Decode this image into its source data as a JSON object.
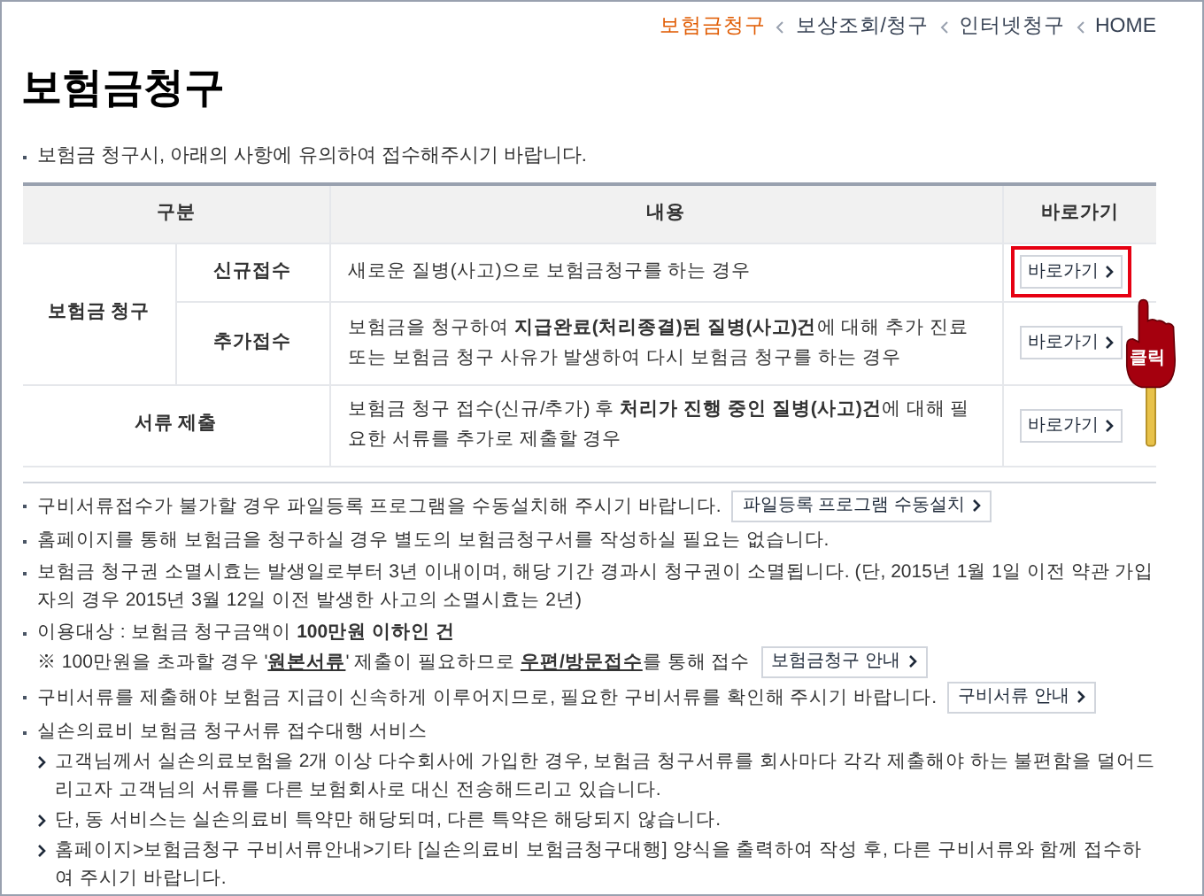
{
  "breadcrumb": [
    {
      "label": "보험금청구",
      "selected": true
    },
    {
      "label": "보상조회/청구",
      "selected": false
    },
    {
      "label": "인터넷청구",
      "selected": false
    },
    {
      "label": "HOME",
      "selected": false
    }
  ],
  "title": "보험금청구",
  "intro": "보험금 청구시, 아래의 사항에 유의하여 접수해주시기 바랍니다.",
  "table": {
    "columns": [
      "구분",
      "내용",
      "바로가기"
    ],
    "rows": [
      {
        "category": "보험금 청구",
        "children": [
          {
            "label": "신규접수",
            "content": "새로운 질병(사고)으로 보험금청구를 하는 경우",
            "button": {
              "label": "바로가기",
              "highlighted": true
            }
          },
          {
            "label": "추가접수",
            "content": "보험금을 청구하여 **지급완료(처리종결)된 질병(사고)건**에 대해 추가 진료 또는 보험금 청구 사유가 발생하여 다시 보험금 청구를 하는 경우",
            "button": {
              "label": "바로가기",
              "highlighted": false
            }
          }
        ]
      },
      {
        "category": "서류 제출",
        "content": "보험금 청구 접수(신규/추가) 후 **처리가 진행 중인 질병(사고)건**에 대해 필요한 서류를 추가로 제출할 경우",
        "button": {
          "label": "바로가기",
          "highlighted": false
        }
      }
    ]
  },
  "click_callout": {
    "label": "클릭"
  },
  "notes": [
    {
      "text": "구비서류접수가 불가할 경우 파일등록 프로그램을 수동설치해 주시기 바랍니다.",
      "button": "파일등록 프로그램 수동설치"
    },
    {
      "text": "홈페이지를 통해 보험금을 청구하실 경우 별도의 보험금청구서를 작성하실 필요는 없습니다."
    },
    {
      "text": "보험금 청구권 소멸시효는 발생일로부터 3년 이내이며, 해당 기간 경과시 청구권이 소멸됩니다. (단, 2015년 1월 1일 이전 약관 가입자의 경우 2015년 3월 12일 이전 발생한 사고의 소멸시효는 2년)"
    },
    {
      "text": "이용대상 : 보험금 청구금액이 **100만원 이하인 건**",
      "remark": "※ 100만원을 초과할 경우 '**원본서류**' 제출이 필요하므로 **우편/방문접수**를 통해 접수",
      "button": "보험금청구 안내"
    },
    {
      "text": "구비서류를 제출해야 보험금 지급이 신속하게 이루어지므로, 필요한 구비서류를 확인해 주시기 바랍니다.",
      "button": "구비서류 안내"
    },
    {
      "text": "실손의료비 보험금 청구서류 접수대행 서비스",
      "children": [
        "고객님께서 실손의료보험을 2개 이상 다수회사에 가입한 경우, 보험금 청구서류를 회사마다 각각 제출해야 하는 불편함을 덜어드리고자 고객님의 서류를 다른 보험회사로 대신 전송해드리고 있습니다.",
        "단, 동 서비스는 실손의료비 특약만 해당되며, 다른 특약은 해당되지 않습니다.",
        "홈페이지>보험금청구 구비서류안내>기타 [실손의료비 보험금청구대행] 양식을 출력하여 작성 후, 다른 구비서류와 함께 접수하여 주시기 바랍니다."
      ]
    }
  ]
}
